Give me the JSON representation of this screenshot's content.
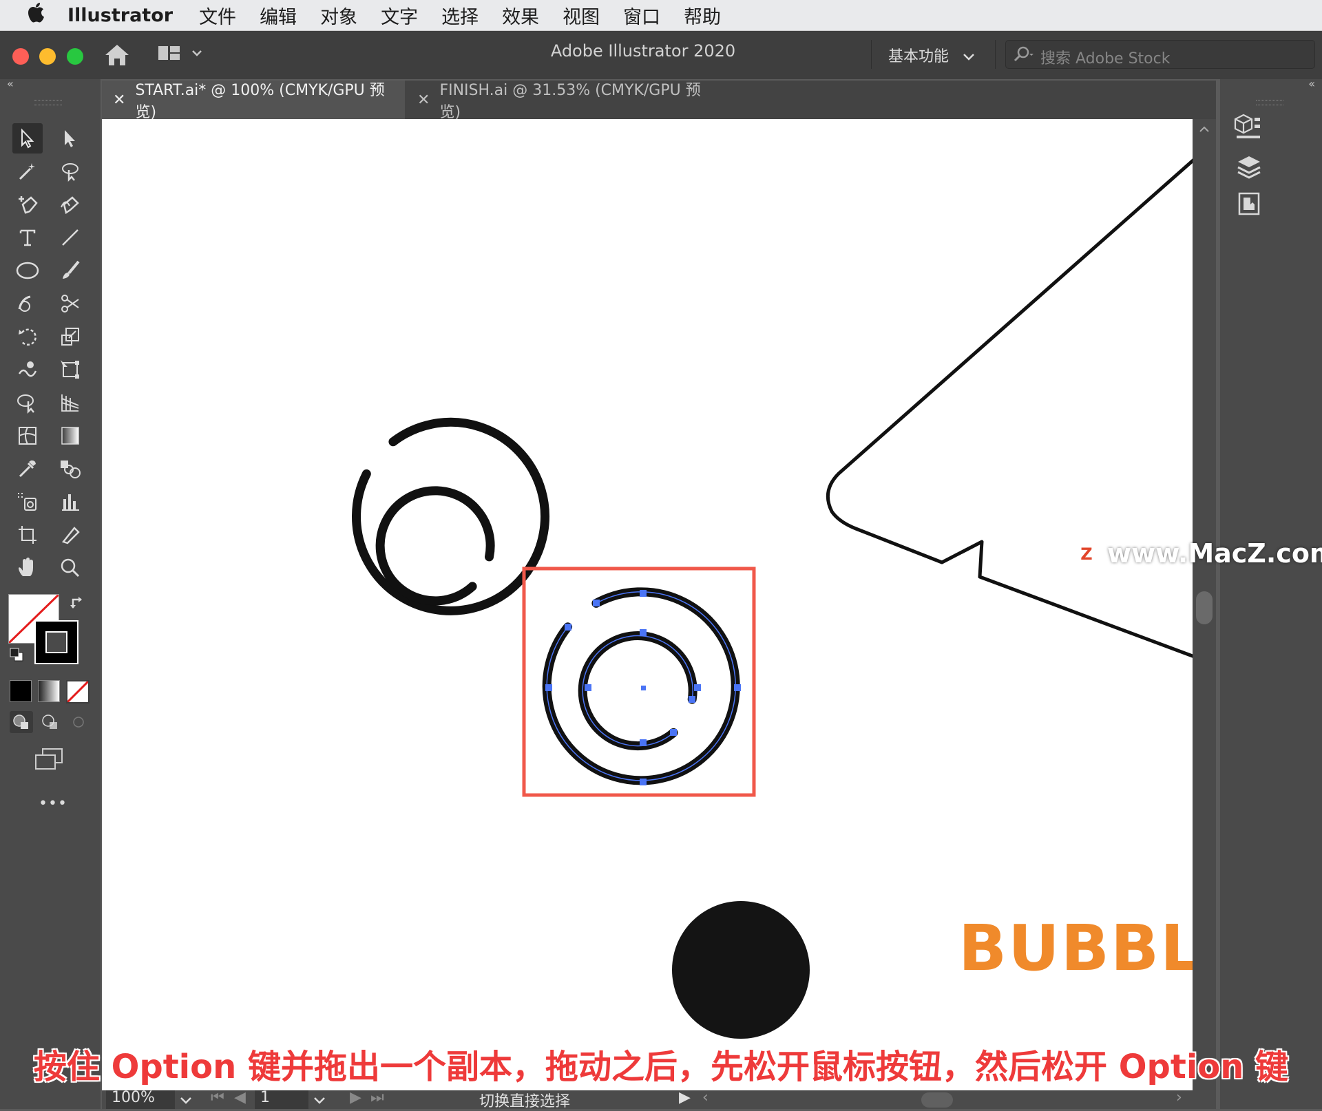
{
  "menubar": {
    "app_name": "Illustrator",
    "items": [
      "文件",
      "编辑",
      "对象",
      "文字",
      "选择",
      "效果",
      "视图",
      "窗口",
      "帮助"
    ]
  },
  "titlebar": {
    "title": "Adobe Illustrator 2020",
    "workspace": "基本功能",
    "search_placeholder": "搜索 Adobe Stock"
  },
  "tabs": [
    {
      "label": "START.ai* @ 100% (CMYK/GPU 预览)",
      "active": true
    },
    {
      "label": "FINISH.ai @ 31.53% (CMYK/GPU 预览)",
      "active": false
    }
  ],
  "toolbar": {
    "tools": [
      "selection-tool",
      "direct-selection-tool",
      "magic-wand-tool",
      "lasso-tool",
      "pen-tool",
      "curvature-tool",
      "type-tool",
      "line-segment-tool",
      "ellipse-tool",
      "paintbrush-tool",
      "shaper-tool",
      "scissors-tool",
      "rotate-tool",
      "scale-tool",
      "warp-tool",
      "free-transform-tool",
      "shape-builder-tool",
      "perspective-grid-tool",
      "mesh-tool",
      "gradient-tool",
      "eyedropper-tool",
      "blend-tool",
      "symbol-sprayer-tool",
      "column-graph-tool",
      "artboard-tool",
      "slice-tool",
      "hand-tool",
      "zoom-tool"
    ],
    "more_label": "•••"
  },
  "canvas": {
    "brand_text": "BUBBLI"
  },
  "statusbar": {
    "zoom": "100%",
    "artboard": "1",
    "status": "切换直接选择"
  },
  "overlay": {
    "subtitle": "按住 Option 键并拖出一个副本，拖动之后，先松开鼠标按钮，然后松开 Option 键",
    "watermark": "www.MacZ.com",
    "watermark_badge": "Z"
  },
  "colors": {
    "accent_orange": "#f08a2b",
    "selection_blue": "#4a74f5",
    "highlight_red": "#f0584a"
  }
}
